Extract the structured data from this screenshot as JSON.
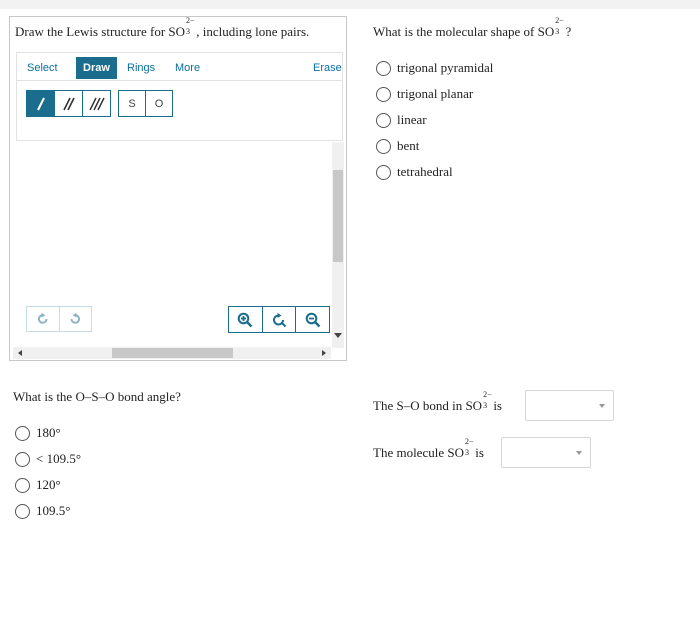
{
  "draw_question": {
    "prompt_before": "Draw the Lewis structure for SO",
    "prompt_sup": "2−",
    "prompt_sub": "3",
    "prompt_after": ", including lone pairs."
  },
  "toolbar": {
    "tabs": [
      {
        "label": "Select",
        "active": false
      },
      {
        "label": "Draw",
        "active": true
      },
      {
        "label": "Rings",
        "active": false
      },
      {
        "label": "More",
        "active": false
      }
    ],
    "erase_label": "Erase",
    "bond_tools": [
      "single-bond",
      "double-bond",
      "triple-bond"
    ],
    "atoms": [
      "S",
      "O"
    ],
    "accent_color": "#1b6d8e"
  },
  "shape_question": {
    "prompt_before": "What is the molecular shape of SO",
    "prompt_sup": "2−",
    "prompt_sub": "3",
    "prompt_after": "?",
    "options": [
      "trigonal pyramidal",
      "trigonal planar",
      "linear",
      "bent",
      "tetrahedral"
    ]
  },
  "angle_question": {
    "prompt": "What is the O–S–O bond angle?",
    "options": [
      "180°",
      "< 109.5°",
      "120°",
      "109.5°"
    ]
  },
  "bond_statement": {
    "prompt_before": "The S–O bond in SO",
    "prompt_sup": "2−",
    "prompt_sub": "3",
    "prompt_after": "is",
    "selected": ""
  },
  "molecule_statement": {
    "prompt_before": "The molecule SO",
    "prompt_sup": "2−",
    "prompt_sub": "3",
    "prompt_after": "is",
    "selected": ""
  }
}
